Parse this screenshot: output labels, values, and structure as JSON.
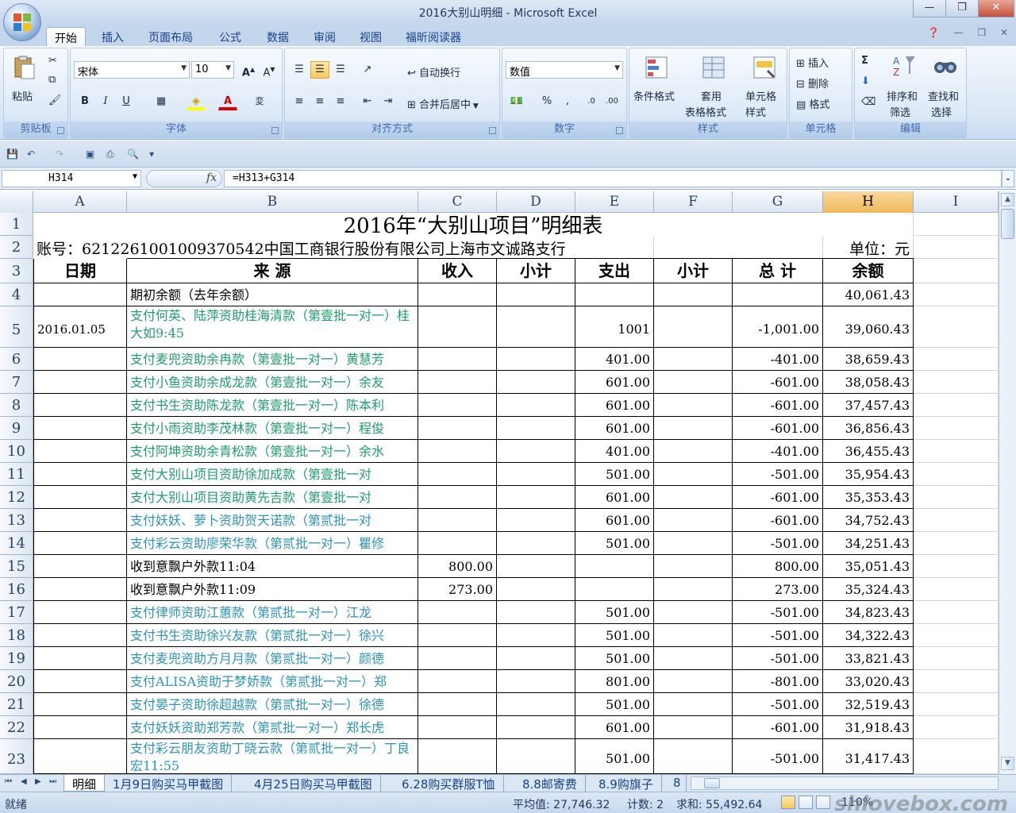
{
  "window": {
    "title": "2016大别山明细 - Microsoft Excel",
    "minimize": "—",
    "restore": "❐",
    "close": "✕"
  },
  "ribbon": {
    "tabs": [
      "开始",
      "插入",
      "页面布局",
      "公式",
      "数据",
      "审阅",
      "视图",
      "福昕阅读器"
    ],
    "active_tab": "开始",
    "clipboard": {
      "label": "剪贴板",
      "paste": "粘贴"
    },
    "font": {
      "label": "字体",
      "name": "宋体",
      "size": "10"
    },
    "alignment": {
      "label": "对齐方式",
      "wrap": "自动换行",
      "merge": "合并后居中"
    },
    "number": {
      "label": "数字",
      "format": "数值"
    },
    "styles": {
      "label": "样式",
      "conditional": "条件格式",
      "table_line1": "套用",
      "table_line2": "表格格式",
      "cell_line1": "单元格",
      "cell_line2": "样式"
    },
    "cells": {
      "label": "单元格",
      "insert": "插入",
      "delete": "删除",
      "format": "格式"
    },
    "editing": {
      "label": "编辑",
      "sort_line1": "排序和",
      "sort_line2": "筛选",
      "find_line1": "查找和",
      "find_line2": "选择"
    }
  },
  "formula_bar": {
    "name_box": "H314",
    "fx": "fx",
    "formula": "=H313+G314"
  },
  "columns": [
    "A",
    "B",
    "C",
    "D",
    "E",
    "F",
    "G",
    "H",
    "I"
  ],
  "selected_column": "H",
  "sheet": {
    "title": "2016年“大别山项目”明细表",
    "account": "账号：6212261001009370542中国工商银行股份有限公司上海市文诚路支行",
    "unit": "单位：元",
    "headers": [
      "日期",
      "来 源",
      "收入",
      "小计",
      "支出",
      "小计",
      "总 计",
      "余额"
    ],
    "rows": [
      {
        "row": "4",
        "date": "",
        "source": "期初余额（去年余额）",
        "income": "",
        "expense": "",
        "total": "",
        "balance": "40,061.43",
        "color": "black"
      },
      {
        "row": "5",
        "date": "2016.01.05",
        "source": "支付何英、陆萍资助桂海清款（第壹批一对一）桂大如9:45",
        "income": "",
        "expense": "1001",
        "total": "-1,001.00",
        "balance": "39,060.43",
        "color": "green"
      },
      {
        "row": "6",
        "date": "",
        "source": "支付麦兜资助余冉款（第壹批一对一）黄慧芳",
        "income": "",
        "expense": "401.00",
        "total": "-401.00",
        "balance": "38,659.43",
        "color": "green"
      },
      {
        "row": "7",
        "date": "",
        "source": "支付小鱼资助余成龙款（第壹批一对一）余友",
        "income": "",
        "expense": "601.00",
        "total": "-601.00",
        "balance": "38,058.43",
        "color": "green"
      },
      {
        "row": "8",
        "date": "",
        "source": "支付书生资助陈龙款（第壹批一对一）陈本利",
        "income": "",
        "expense": "601.00",
        "total": "-601.00",
        "balance": "37,457.43",
        "color": "green"
      },
      {
        "row": "9",
        "date": "",
        "source": "支付小雨资助李茂林款（第壹批一对一）程俊",
        "income": "",
        "expense": "601.00",
        "total": "-601.00",
        "balance": "36,856.43",
        "color": "green"
      },
      {
        "row": "10",
        "date": "",
        "source": "支付阿坤资助余青松款（第壹批一对一）余水",
        "income": "",
        "expense": "401.00",
        "total": "-401.00",
        "balance": "36,455.43",
        "color": "green"
      },
      {
        "row": "11",
        "date": "",
        "source": "支付大别山项目资助徐加成款（第壹批一对",
        "income": "",
        "expense": "501.00",
        "total": "-501.00",
        "balance": "35,954.43",
        "color": "green"
      },
      {
        "row": "12",
        "date": "",
        "source": "支付大别山项目资助黄先吉款（第壹批一对",
        "income": "",
        "expense": "601.00",
        "total": "-601.00",
        "balance": "35,353.43",
        "color": "green"
      },
      {
        "row": "13",
        "date": "",
        "source": "支付妖妖、萝卜资助贺天诺款（第贰批一对",
        "income": "",
        "expense": "601.00",
        "total": "-601.00",
        "balance": "34,752.43",
        "color": "teal"
      },
      {
        "row": "14",
        "date": "",
        "source": "支付彩云资助廖荣华款（第贰批一对一）瞿修",
        "income": "",
        "expense": "501.00",
        "total": "-501.00",
        "balance": "34,251.43",
        "color": "teal"
      },
      {
        "row": "15",
        "date": "",
        "source": "收到意飘户外款11:04",
        "income": "800.00",
        "expense": "",
        "total": "800.00",
        "balance": "35,051.43",
        "color": "black"
      },
      {
        "row": "16",
        "date": "",
        "source": "收到意飘户外款11:09",
        "income": "273.00",
        "expense": "",
        "total": "273.00",
        "balance": "35,324.43",
        "color": "black"
      },
      {
        "row": "17",
        "date": "",
        "source": "支付律师资助江蕙款（第贰批一对一）江龙",
        "income": "",
        "expense": "501.00",
        "total": "-501.00",
        "balance": "34,823.43",
        "color": "teal"
      },
      {
        "row": "18",
        "date": "",
        "source": "支付书生资助徐兴友款（第贰批一对一）徐兴",
        "income": "",
        "expense": "501.00",
        "total": "-501.00",
        "balance": "34,322.43",
        "color": "teal"
      },
      {
        "row": "19",
        "date": "",
        "source": "支付麦兜资助方月月款（第贰批一对一）颜德",
        "income": "",
        "expense": "501.00",
        "total": "-501.00",
        "balance": "33,821.43",
        "color": "teal"
      },
      {
        "row": "20",
        "date": "",
        "source": "支付ALISA资助于梦娇款（第贰批一对一）郑",
        "income": "",
        "expense": "801.00",
        "total": "-801.00",
        "balance": "33,020.43",
        "color": "teal"
      },
      {
        "row": "21",
        "date": "",
        "source": "支付晏子资助徐超越款（第贰批一对一）徐德",
        "income": "",
        "expense": "501.00",
        "total": "-501.00",
        "balance": "32,519.43",
        "color": "teal"
      },
      {
        "row": "22",
        "date": "",
        "source": "支付妖妖资助郑芳款（第贰批一对一）郑长虎",
        "income": "",
        "expense": "601.00",
        "total": "-601.00",
        "balance": "31,918.43",
        "color": "teal"
      },
      {
        "row": "23",
        "date": "",
        "source": "支付彩云朋友资助丁晓云款（第贰批一对一）丁良宏11:55",
        "income": "",
        "expense": "501.00",
        "total": "-501.00",
        "balance": "31,417.43",
        "color": "teal"
      }
    ]
  },
  "sheet_tabs": [
    "明细",
    "1月9日购买马甲截图",
    "4月25日购买马甲截图",
    "6.28购买群服T恤",
    "8.8邮寄费",
    "8.9购旗子",
    "8"
  ],
  "status": {
    "ready": "就绪",
    "average": "平均值: 27,746.32",
    "count": "计数: 2",
    "sum": "求和: 55,492.64",
    "zoom": "110%",
    "watermark": "shlovebox.com"
  }
}
